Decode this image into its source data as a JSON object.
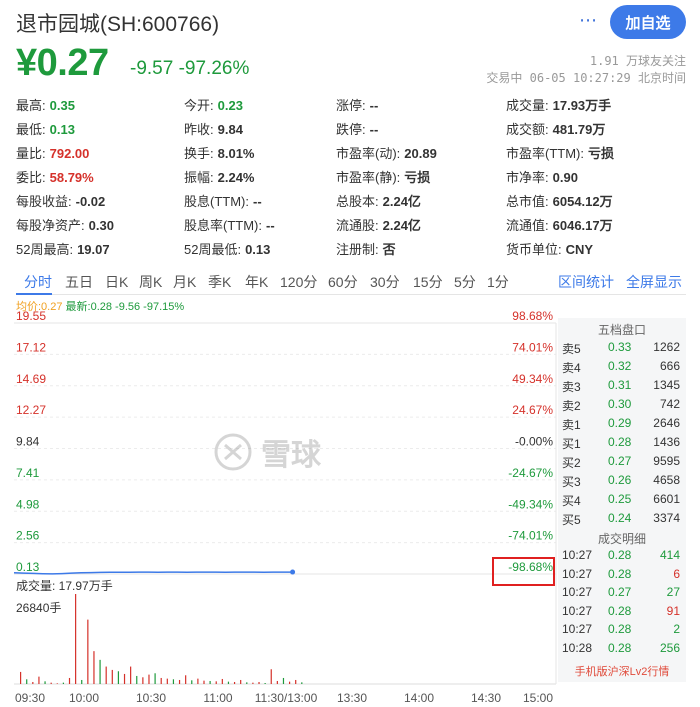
{
  "header": {
    "title": "退市园城(SH:600766)",
    "more_icon": "⋯",
    "follow_label": "加自选"
  },
  "quote": {
    "price": "¥0.27",
    "change": "-9.57  -97.26%",
    "followers": "1.91 万球友关注",
    "trade_time": "交易中 06-05 10:27:29 北京时间"
  },
  "stats": [
    [
      [
        "最高:",
        "0.35",
        "green"
      ],
      [
        "今开:",
        "0.23",
        "green"
      ],
      [
        "涨停:",
        "--",
        "black"
      ],
      [
        "成交量:",
        "17.93万手",
        "black"
      ]
    ],
    [
      [
        "最低:",
        "0.13",
        "green"
      ],
      [
        "昨收:",
        "9.84",
        "black"
      ],
      [
        "跌停:",
        "--",
        "black"
      ],
      [
        "成交额:",
        "481.79万",
        "black"
      ]
    ],
    [
      [
        "量比:",
        "792.00",
        "red"
      ],
      [
        "换手:",
        "8.01%",
        "black"
      ],
      [
        "市盈率(动):",
        "20.89",
        "black"
      ],
      [
        "市盈率(TTM):",
        "亏损",
        "black"
      ]
    ],
    [
      [
        "委比:",
        "58.79%",
        "red"
      ],
      [
        "振幅:",
        "2.24%",
        "black"
      ],
      [
        "市盈率(静):",
        "亏损",
        "black"
      ],
      [
        "市净率:",
        "0.90",
        "black"
      ]
    ],
    [
      [
        "每股收益:",
        "-0.02",
        "black"
      ],
      [
        "股息(TTM):",
        "--",
        "black"
      ],
      [
        "总股本:",
        "2.24亿",
        "black"
      ],
      [
        "总市值:",
        "6054.12万",
        "black"
      ]
    ],
    [
      [
        "每股净资产:",
        "0.30",
        "black"
      ],
      [
        "股息率(TTM):",
        "--",
        "black"
      ],
      [
        "流通股:",
        "2.24亿",
        "black"
      ],
      [
        "流通值:",
        "6046.17万",
        "black"
      ]
    ],
    [
      [
        "52周最高:",
        "19.07",
        "black"
      ],
      [
        "52周最低:",
        "0.13",
        "black"
      ],
      [
        "注册制:",
        "否",
        "black"
      ],
      [
        "货币单位:",
        "CNY",
        "black"
      ]
    ]
  ],
  "tabs": [
    "分时",
    "五日",
    "日K",
    "周K",
    "月K",
    "季K",
    "年K",
    "120分",
    "60分",
    "30分",
    "15分",
    "5分",
    "1分"
  ],
  "tabs_right": [
    "区间统计",
    "全屏显示"
  ],
  "legend": {
    "avg": "均价:0.27",
    "latest": "最新:0.28 -9.56 -97.15%"
  },
  "chart_data": {
    "type": "line",
    "price_ticks": [
      "19.55",
      "17.12",
      "14.69",
      "12.27",
      "9.84",
      "7.41",
      "4.98",
      "2.56",
      "0.13"
    ],
    "pct_ticks": [
      "98.68%",
      "74.01%",
      "49.34%",
      "24.67%",
      "-0.00%",
      "-24.67%",
      "-49.34%",
      "-74.01%",
      "-98.68%"
    ],
    "ylim": [
      0.13,
      19.55
    ],
    "time_ticks": [
      "09:30",
      "10:00",
      "10:30",
      "11:00",
      "11:30/13:00",
      "13:30",
      "14:00",
      "14:30",
      "15:00"
    ],
    "price_series": [
      0.23,
      0.2,
      0.18,
      0.15,
      0.14,
      0.16,
      0.2,
      0.22,
      0.24,
      0.25,
      0.26,
      0.27,
      0.27,
      0.28,
      0.28,
      0.27,
      0.28,
      0.28,
      0.27,
      0.28,
      0.28,
      0.28,
      0.27,
      0.28,
      0.28,
      0.28,
      0.27,
      0.28,
      0.28,
      0.28
    ],
    "volume_label": "成交量: 17.97万手",
    "volume_max_label": "26840手",
    "volume_max": 26840,
    "volumes": [
      3600,
      1400,
      600,
      2200,
      800,
      400,
      200,
      400,
      1800,
      26840,
      1200,
      19200,
      9800,
      7200,
      5200,
      4200,
      3800,
      3000,
      5200,
      2400,
      2000,
      2800,
      3200,
      1800,
      1600,
      1400,
      1200,
      2600,
      1100,
      1600,
      1000,
      900,
      800,
      1500,
      700,
      600,
      1200,
      500,
      400,
      600,
      300,
      4400,
      900,
      1800,
      700,
      1200,
      500
    ]
  },
  "orderbook": {
    "title": "五档盘口",
    "rows": [
      [
        "卖5",
        "0.33",
        "1262"
      ],
      [
        "卖4",
        "0.32",
        "666"
      ],
      [
        "卖3",
        "0.31",
        "1345"
      ],
      [
        "卖2",
        "0.30",
        "742"
      ],
      [
        "卖1",
        "0.29",
        "2646"
      ],
      [
        "买1",
        "0.28",
        "1436"
      ],
      [
        "买2",
        "0.27",
        "9595"
      ],
      [
        "买3",
        "0.26",
        "4658"
      ],
      [
        "买4",
        "0.25",
        "6601"
      ],
      [
        "买5",
        "0.24",
        "3374"
      ]
    ],
    "trades_title": "成交明细",
    "trades": [
      [
        "10:27",
        "0.28",
        "414",
        "green"
      ],
      [
        "10:27",
        "0.28",
        "6",
        "red"
      ],
      [
        "10:27",
        "0.27",
        "27",
        "green"
      ],
      [
        "10:27",
        "0.28",
        "91",
        "red"
      ],
      [
        "10:27",
        "0.28",
        "2",
        "green"
      ],
      [
        "10:28",
        "0.28",
        "256",
        "green"
      ]
    ],
    "footer": "手机版沪深Lv2行情"
  },
  "watermark": {
    "text": "雪球"
  },
  "colors": {
    "accent": "#3d7ae8",
    "down": "#1e9a3c",
    "up": "#d5312a",
    "avg": "#f0a020"
  }
}
